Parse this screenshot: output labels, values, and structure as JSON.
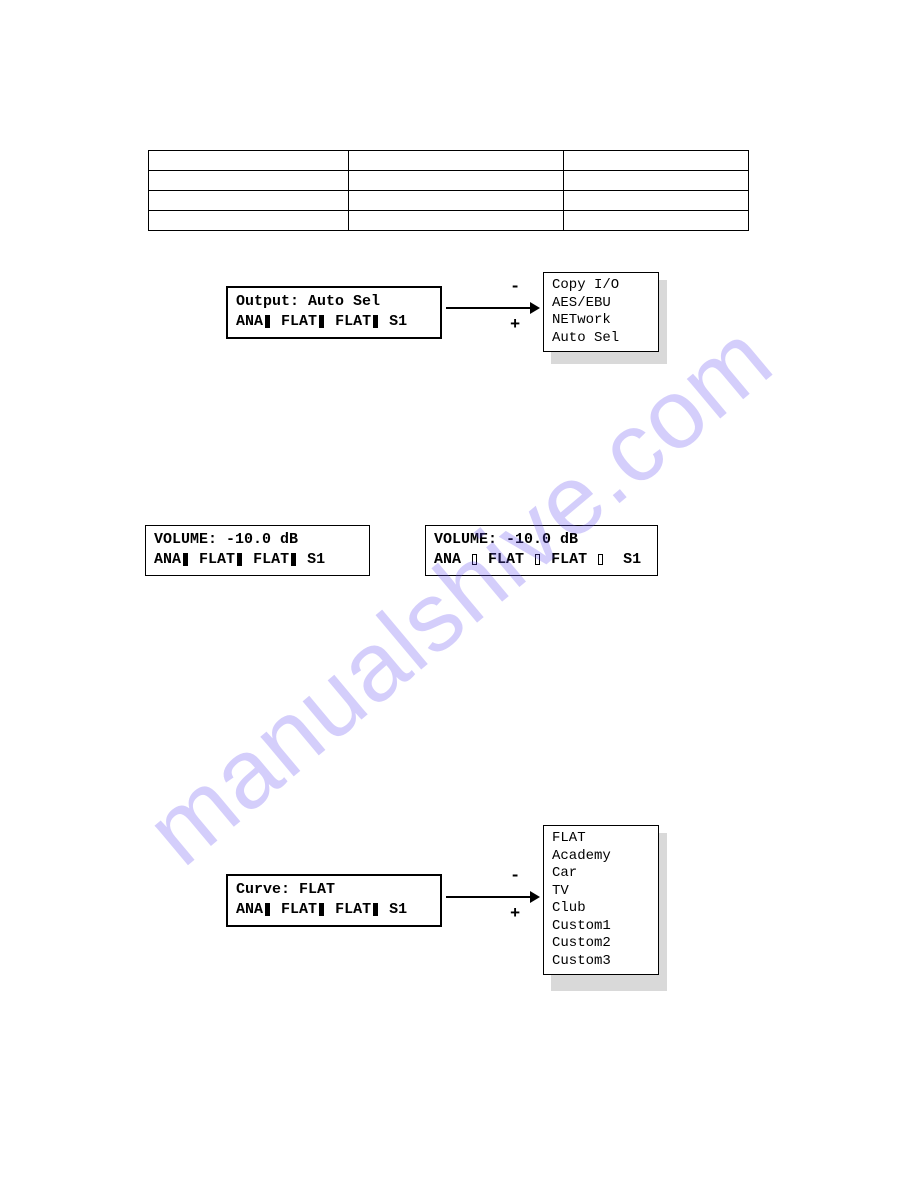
{
  "watermark": "manualshive.com",
  "diagram1": {
    "lcd": {
      "line1": "Output: Auto Sel",
      "line2_parts": [
        "ANA",
        "FLAT",
        "FLAT",
        "S1"
      ]
    },
    "minus": "-",
    "plus": "+",
    "options": [
      "Copy I/O",
      "AES/EBU",
      "NETwork",
      "Auto Sel"
    ]
  },
  "volume_left": {
    "line1": "VOLUME: -10.0 dB",
    "line2_parts": [
      "ANA",
      "FLAT",
      "FLAT",
      "S1"
    ]
  },
  "volume_right": {
    "line1": "VOLUME: -10.0 dB",
    "line2_parts": [
      "ANA",
      "FLAT",
      "FLAT",
      "S1"
    ]
  },
  "diagram2": {
    "lcd": {
      "line1": "Curve: FLAT",
      "line2_parts": [
        "ANA",
        "FLAT",
        "FLAT",
        "S1"
      ]
    },
    "minus": "-",
    "plus": "+",
    "options": [
      "FLAT",
      "Academy",
      "Car",
      "TV",
      "Club",
      "Custom1",
      "Custom2",
      "Custom3"
    ]
  }
}
